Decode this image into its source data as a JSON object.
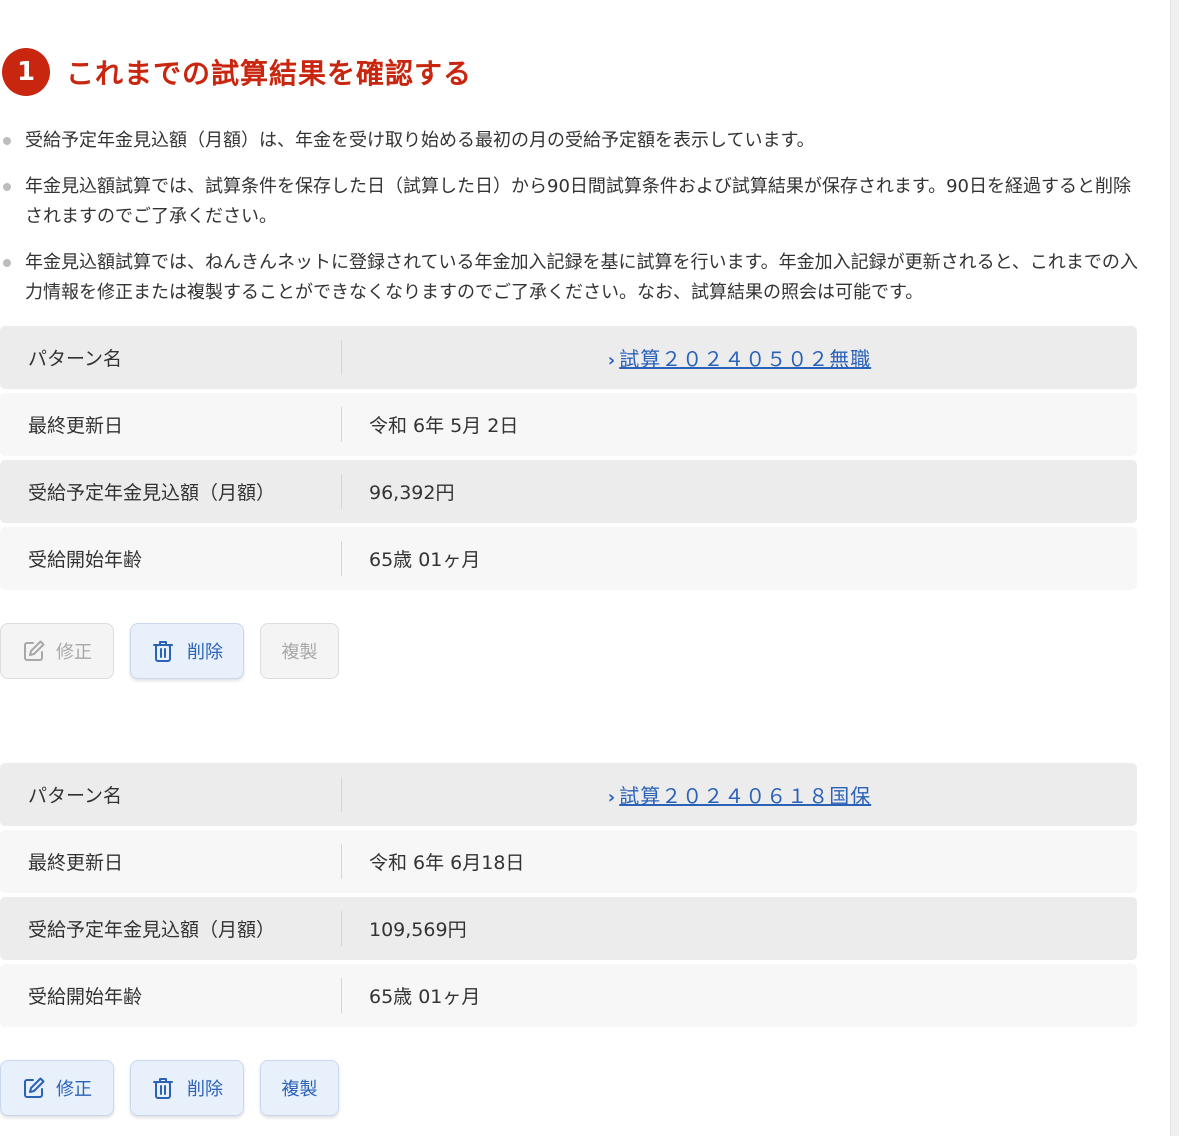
{
  "heading": {
    "number": "1",
    "title": "これまでの試算結果を確認する"
  },
  "notes": [
    "受給予定年金見込額（月額）は、年金を受け取り始める最初の月の受給予定額を表示しています。",
    "年金見込額試算では、試算条件を保存した日（試算した日）から90日間試算条件および試算結果が保存されます。90日を経過すると削除されますのでご了承ください。",
    "年金見込額試算では、ねんきんネットに登録されている年金加入記録を基に試算を行います。年金加入記録が更新されると、これまでの入力情報を修正または複製することができなくなりますのでご了承ください。なお、試算結果の照会は可能です。"
  ],
  "labels": {
    "pattern_name": "パターン名",
    "last_updated": "最終更新日",
    "monthly_amount": "受給予定年金見込額（月額）",
    "start_age": "受給開始年齢"
  },
  "buttons": {
    "edit": "修正",
    "delete": "削除",
    "duplicate": "複製"
  },
  "results": [
    {
      "pattern_name": "試算２０２４０５０２無職",
      "last_updated": "令和 6年 5月 2日",
      "monthly_amount": "96,392円",
      "start_age": "65歳 01ヶ月",
      "edit_enabled": false,
      "delete_enabled": true,
      "duplicate_enabled": false
    },
    {
      "pattern_name": "試算２０２４０６１８国保",
      "last_updated": "令和 6年 6月18日",
      "monthly_amount": "109,569円",
      "start_age": "65歳 01ヶ月",
      "edit_enabled": true,
      "delete_enabled": true,
      "duplicate_enabled": true
    }
  ],
  "colors": {
    "accent_red": "#c8260f",
    "link_blue": "#2a62b8"
  },
  "icons": {
    "edit": "edit-icon",
    "delete": "trash-icon",
    "link": "chevron-right-icon"
  }
}
